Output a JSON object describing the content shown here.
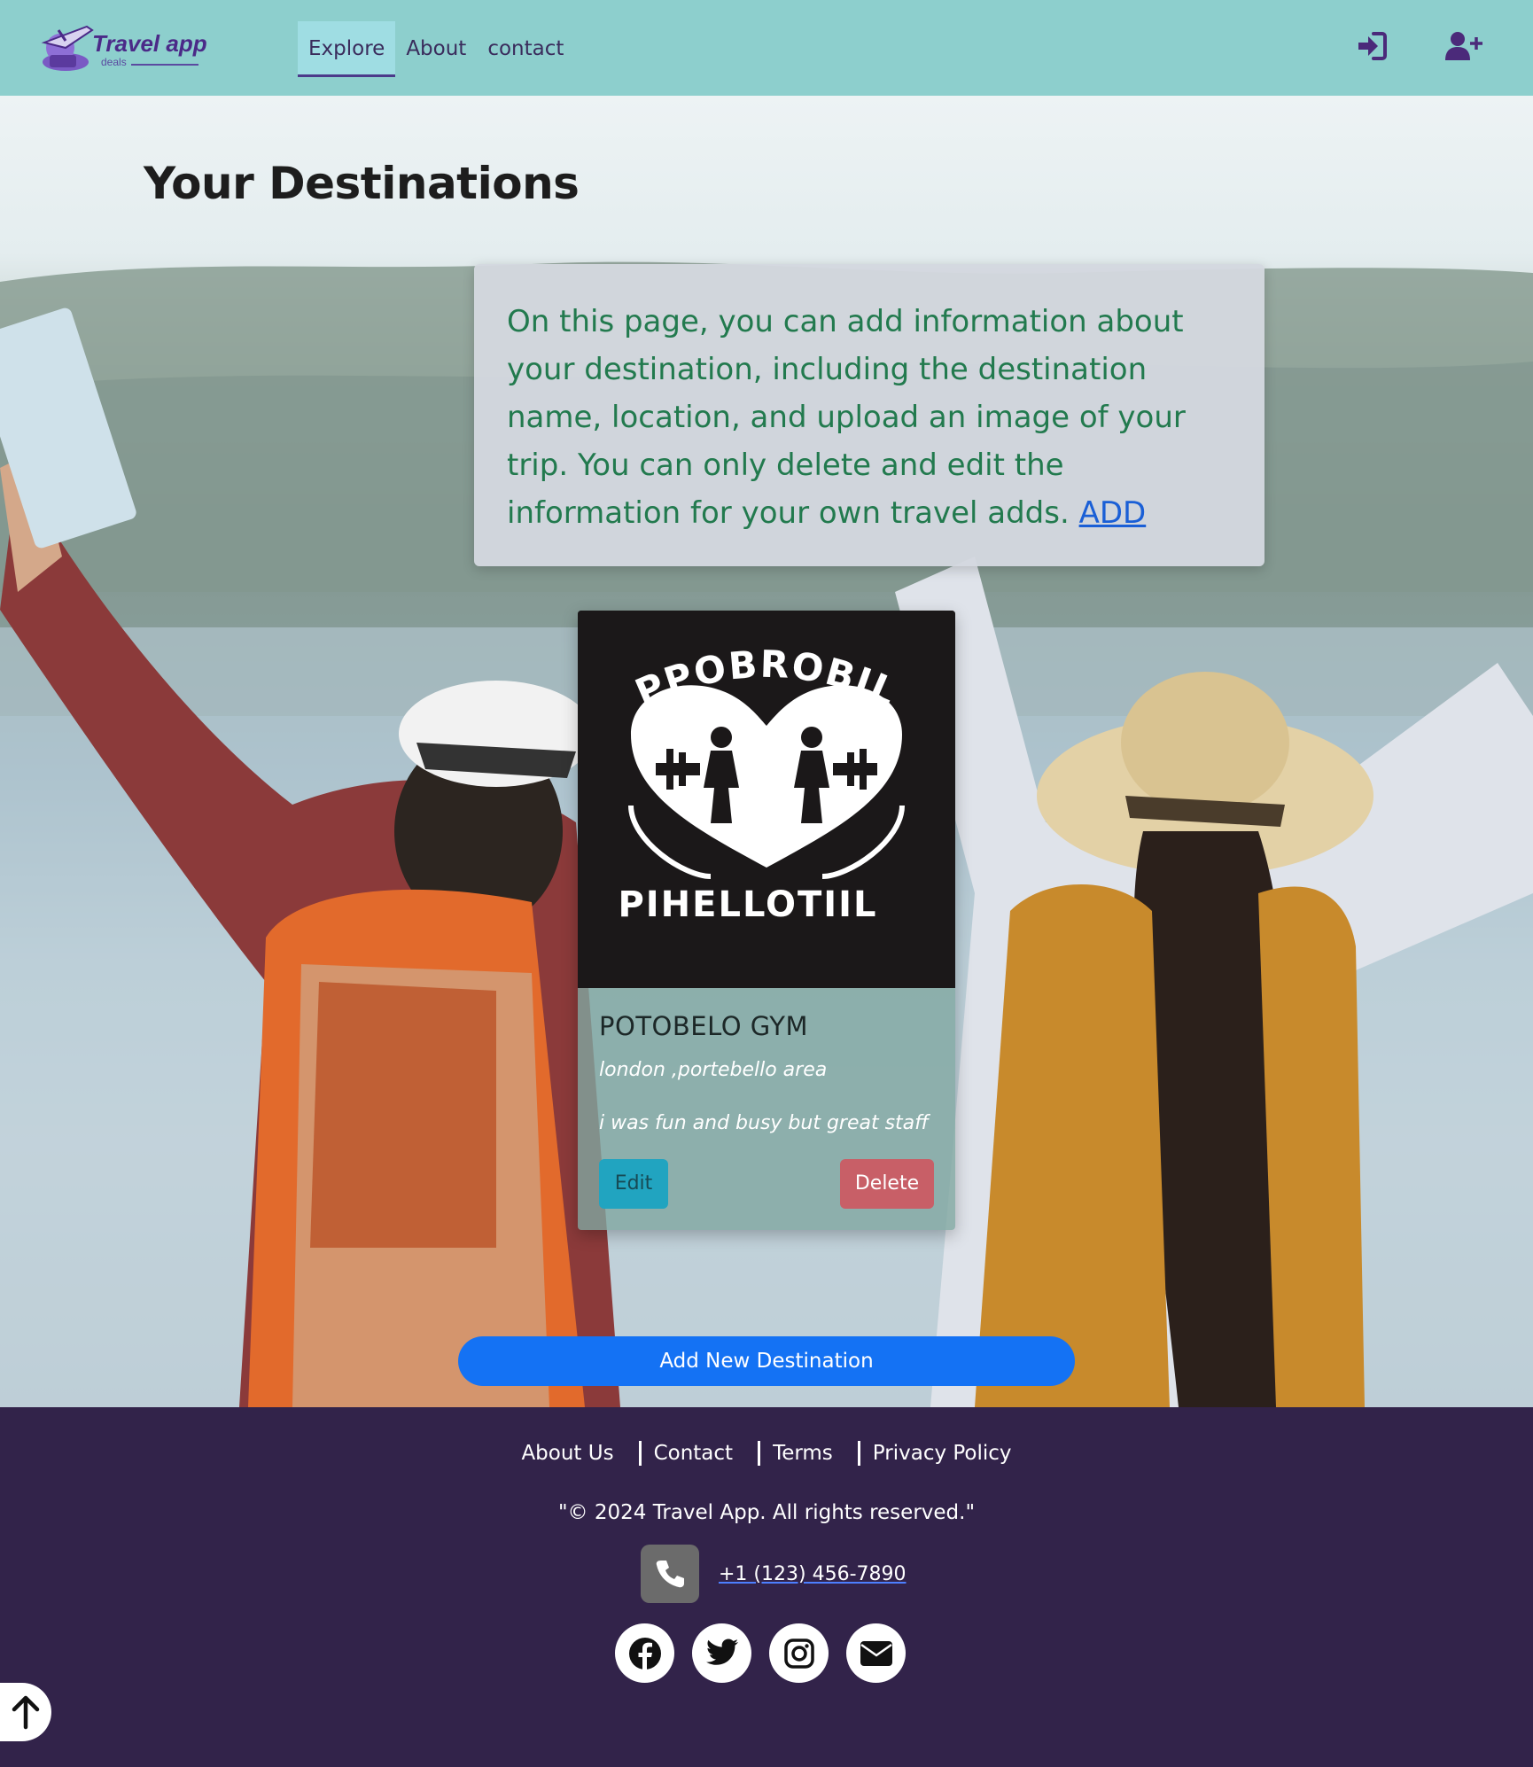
{
  "nav": {
    "logo_text": "Travel app",
    "logo_sub": "deals",
    "links": [
      "Explore",
      "About",
      "contact"
    ],
    "active_link": "Explore",
    "icons": [
      "sign-in-icon",
      "user-plus-icon"
    ]
  },
  "main": {
    "title": "Your Destinations",
    "info_text": "On this page, you can add information about your destination, including the destination name, location, and upload an image of your trip. You can only delete and edit the information for your own travel adds.",
    "info_link": "ADD",
    "add_button": "Add New Destination"
  },
  "card": {
    "image_top_text": "PPOBROBIL",
    "image_bottom_text": "PIHELLOTIIL",
    "title": "POTOBELO GYM",
    "location": "london ,portebello area",
    "description": "i was fun and busy but great staff",
    "edit_label": "Edit",
    "delete_label": "Delete"
  },
  "footer": {
    "links": [
      "About Us",
      "Contact",
      "Terms",
      "Privacy Policy"
    ],
    "copyright": "\"© 2024 Travel App. All rights reserved.\"",
    "phone": "+1 (123) 456-7890",
    "socials": [
      "facebook-icon",
      "twitter-icon",
      "instagram-icon",
      "envelope-icon"
    ]
  },
  "colors": {
    "navbar": "#8dcfcd",
    "footer": "#32234a",
    "info_text": "#227a4e",
    "primary_button": "#1472f4",
    "edit_button": "#21a4c0",
    "delete_button": "#c85f67"
  }
}
